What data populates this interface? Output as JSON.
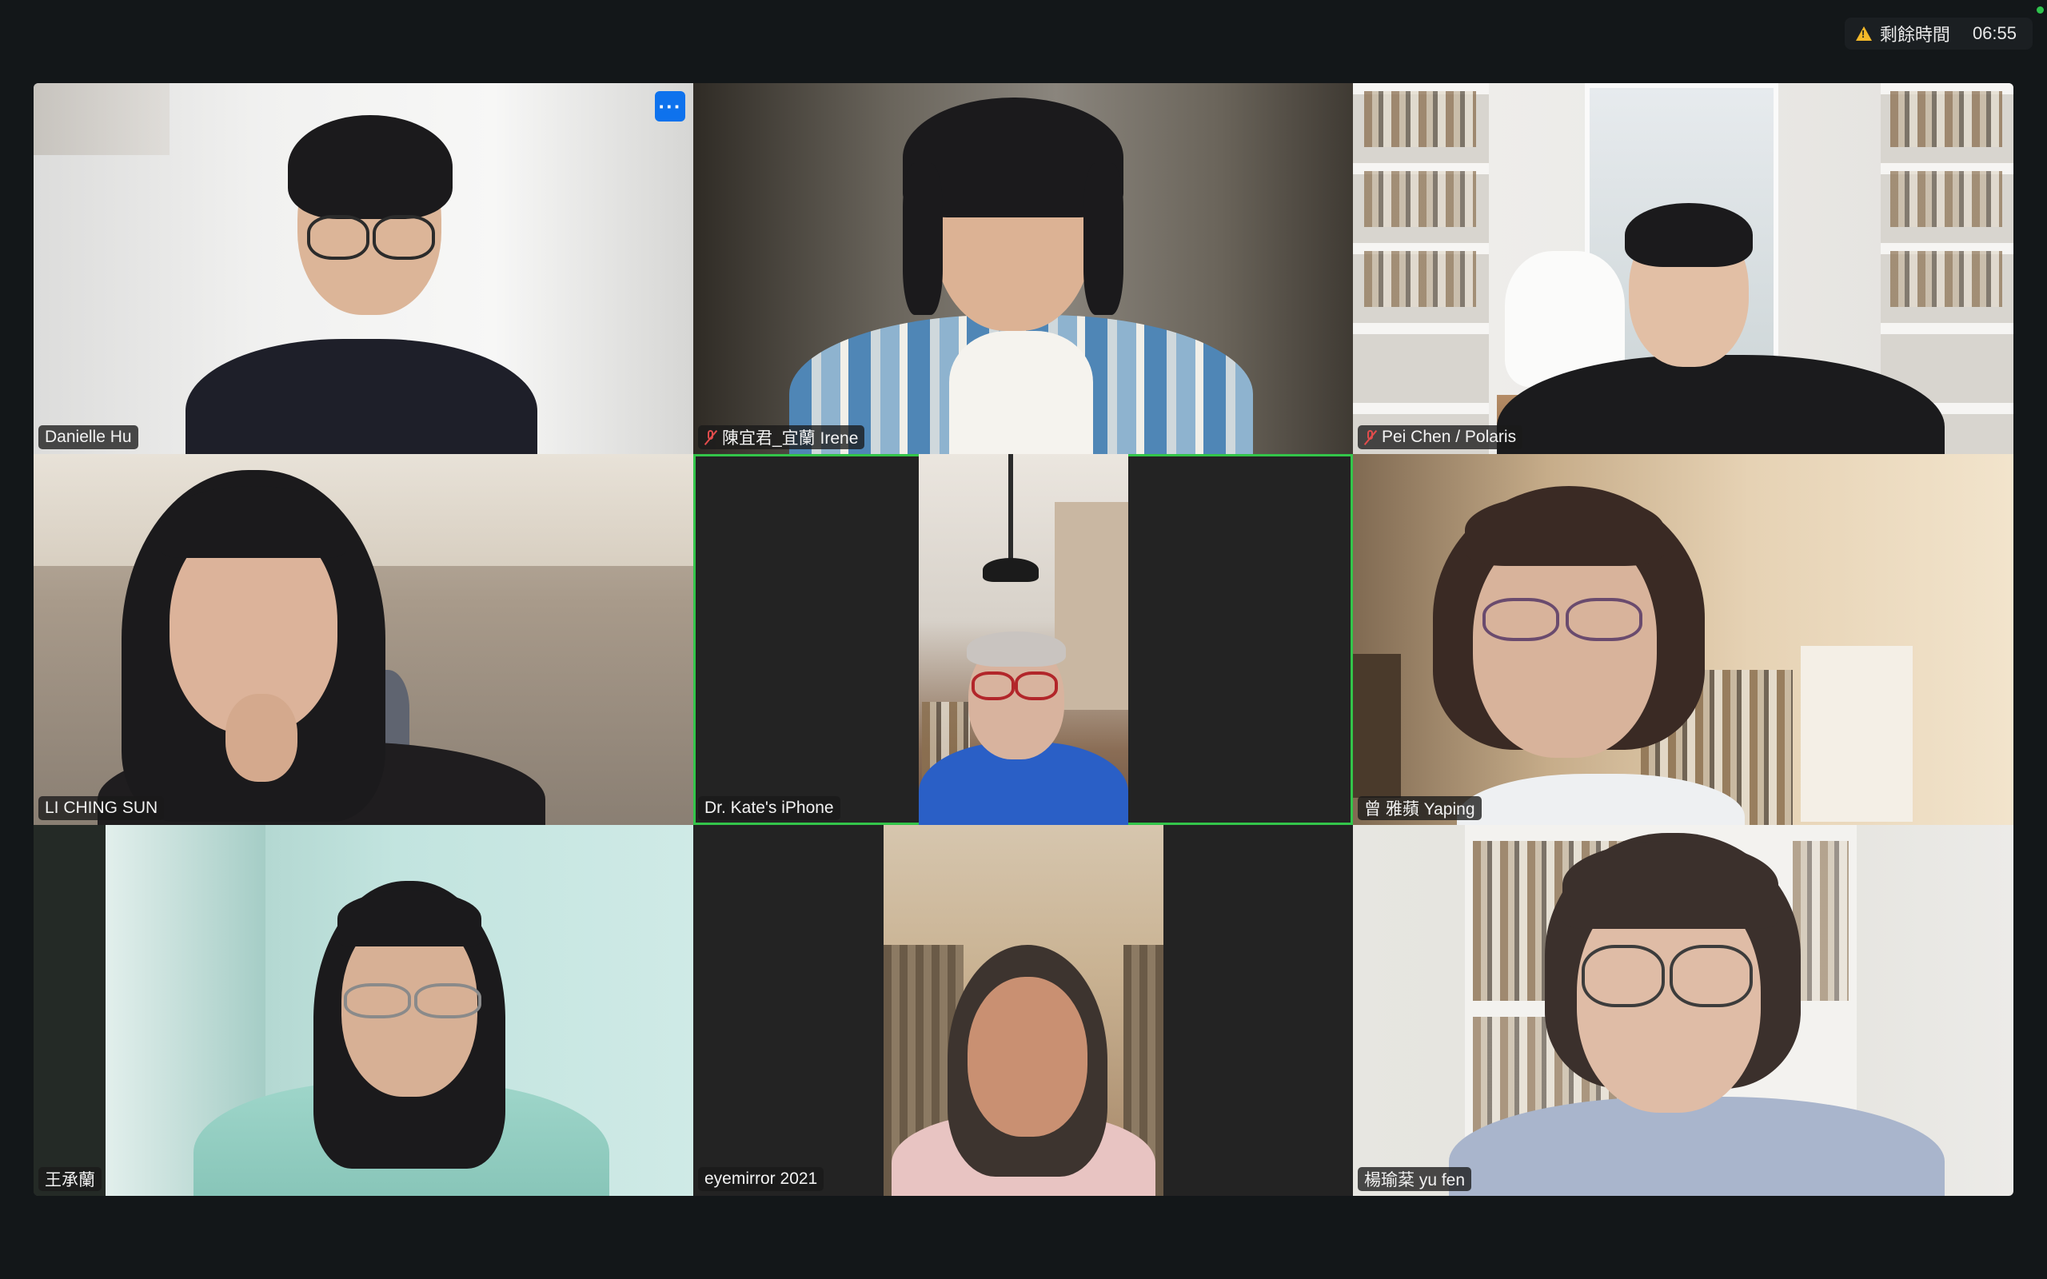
{
  "timer": {
    "label": "剩餘時間",
    "time": "06:55",
    "warning_icon": "warning-icon"
  },
  "participants": [
    {
      "name": "Danielle Hu",
      "muted": false,
      "active_speaker": false
    },
    {
      "name": "陳宜君_宜蘭 Irene",
      "muted": true,
      "active_speaker": false
    },
    {
      "name": "Pei Chen / Polaris",
      "muted": true,
      "active_speaker": false
    },
    {
      "name": "LI CHING SUN",
      "muted": false,
      "active_speaker": false
    },
    {
      "name": "Dr. Kate's iPhone",
      "muted": false,
      "active_speaker": true
    },
    {
      "name": "曾 雅蘋 Yaping",
      "muted": false,
      "active_speaker": false
    },
    {
      "name": "王承蘭",
      "muted": false,
      "active_speaker": false
    },
    {
      "name": "eyemirror 2021",
      "muted": false,
      "active_speaker": false
    },
    {
      "name": "楊瑜棻 yu fen",
      "muted": false,
      "active_speaker": false
    }
  ],
  "more_button": {
    "label": "···"
  },
  "colors": {
    "background": "#131719",
    "active_speaker_border": "#33c54a",
    "more_button": "#0e72ed",
    "muted_icon": "#e24c4c",
    "warning": "#f3b829"
  }
}
